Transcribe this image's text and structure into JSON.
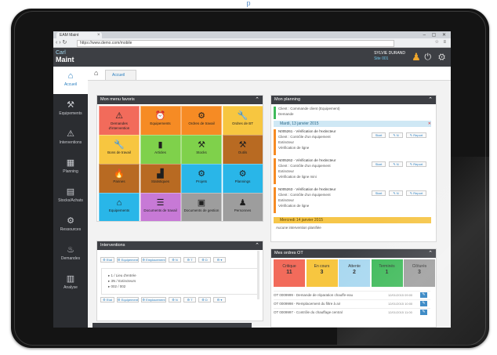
{
  "caption": "p",
  "browser": {
    "tab_label": "EAM Maint",
    "url": "https://www.demo.com/mobile",
    "win_controls": "– ▢ ✕",
    "nav_icons": "‹ › ↻",
    "toolbar_icons": "☆ ≡"
  },
  "header": {
    "logo_top": "Carl",
    "logo_main": "Maint",
    "user_name": "SYLVIE DURAND",
    "user_sub": "Site 001",
    "icons": "⏻ ⚙"
  },
  "sidebar": {
    "items": [
      {
        "icon": "⌂",
        "label": "Accueil"
      },
      {
        "icon": "⚒",
        "label": "Equipements"
      },
      {
        "icon": "⚠",
        "label": "Interventions"
      },
      {
        "icon": "▦",
        "label": "Planning"
      },
      {
        "icon": "▤",
        "label": "Stocks/Achats"
      },
      {
        "icon": "⚙",
        "label": "Ressources"
      },
      {
        "icon": "♨",
        "label": "Demandes"
      },
      {
        "icon": "▥",
        "label": "Analyse"
      }
    ]
  },
  "tabs": {
    "home_icon": "⌂",
    "active_tab": "Accueil"
  },
  "menu_panel": {
    "title": "Mon menu favoris",
    "caret": "⌃",
    "tiles": [
      {
        "label": "Demandes d'intervention",
        "icon": "⚠",
        "color": "#f26b5b"
      },
      {
        "label": "Equipements",
        "icon": "⏰",
        "color": "#f68b24"
      },
      {
        "label": "Ordres de travail",
        "icon": "⚙",
        "color": "#f68b24"
      },
      {
        "label": "Ordres de BT",
        "icon": "🔧",
        "color": "#f7c640"
      },
      {
        "label": "Bons de travail",
        "icon": "🔧",
        "color": "#f7c640"
      },
      {
        "label": "Articles",
        "icon": "▮",
        "color": "#7fd14b"
      },
      {
        "label": "Stocks",
        "icon": "⚒",
        "color": "#7fd14b"
      },
      {
        "label": "Outils",
        "icon": "⚒",
        "color": "#b86a22"
      },
      {
        "label": "Pannes",
        "icon": "🔥",
        "color": "#b86a22"
      },
      {
        "label": "Statistiques",
        "icon": "▟",
        "color": "#b86a22"
      },
      {
        "label": "Projets",
        "icon": "⚙",
        "color": "#29b6e8"
      },
      {
        "label": "Plannings",
        "icon": "⚙",
        "color": "#29b6e8"
      },
      {
        "label": "Equipements",
        "icon": "⌂",
        "color": "#29b6e8"
      },
      {
        "label": "Documents de travail",
        "icon": "☰",
        "color": "#c779d6"
      },
      {
        "label": "Documents de gestion",
        "icon": "▣",
        "color": "#9d9d9d"
      },
      {
        "label": "Personnes",
        "icon": "♟",
        "color": "#9d9d9d"
      }
    ]
  },
  "planning_panel": {
    "title": "Mon planning",
    "caret": "⌃",
    "top_note": "Client : Commande client (Equipement)",
    "top_sub": "Demande",
    "date1": "Mardi, 13 janvier 2015",
    "close_icon": "✕",
    "entries": [
      {
        "title": "N005261 - Vérification de l'extincteur",
        "line2": "Client : Contrôle d'un équipement",
        "line3": "Extincteur",
        "line4": "Vérification de ligne"
      },
      {
        "title": "N005262 - Vérification de l'extincteur",
        "line2": "Client : Contrôle d'un équipement",
        "line3": "Extincteur",
        "line4": "Vérification de ligne mini"
      },
      {
        "title": "N005263 - Vérification de l'extincteur",
        "line2": "Client : Contrôle d'un équipement",
        "line3": "Extincteur",
        "line4": "Vérification de ligne"
      }
    ],
    "btn_start": "Start",
    "btn_mid": "✎ N",
    "btn_report": "✎ Report",
    "date2": "Mercredi 14 janvier 2015",
    "bottom_note": "Aucune intervention planifiée"
  },
  "interventions_panel": {
    "title": "Interventions",
    "caret": "⌃",
    "buttons": [
      "⚙ Etat",
      "⚙ Equipement",
      "⚙ Emplacement",
      "⚙ N",
      "⚙ T",
      "⚙ D",
      "⚙ ▾"
    ],
    "items": [
      "▸ 1 / Lieu d'entrée",
      "▸ 3N / Extincteurs",
      "▸ 002 / 002"
    ]
  },
  "ot_panel": {
    "title": "Mes ordres OT",
    "caret": "⌃",
    "boxes": [
      {
        "label": "Critique",
        "value": "11",
        "color": "#f26b5b"
      },
      {
        "label": "En cours",
        "value": "3",
        "color": "#f7c640"
      },
      {
        "label": "Attente",
        "value": "2",
        "color": "#a9d8f0"
      },
      {
        "label": "Terminés",
        "value": "1",
        "color": "#3fba5a"
      },
      {
        "label": "Clôturés",
        "value": "3",
        "color": "#9d9d9d"
      }
    ],
    "rows": [
      {
        "text": "OT 0009999 - Demande de réparation chauffe-eau",
        "date": "12/01/2015 09:00",
        "btn": "✎"
      },
      {
        "text": "OT 0009998 - Remplacement du filtre à air",
        "date": "12/01/2015 10:00",
        "btn": "✎"
      },
      {
        "text": "OT 0009997 - Contrôle du chauffage central",
        "date": "12/01/2015 11:00",
        "btn": "✎"
      }
    ]
  }
}
